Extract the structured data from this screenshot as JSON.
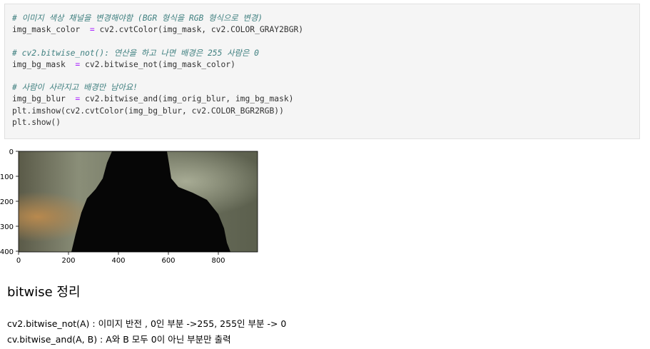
{
  "code": {
    "lines": [
      {
        "kind": "comment",
        "text": "# 이미지 색상 채널을 변경해야함 (BGR 형식을 RGB 형식으로 변경)"
      },
      {
        "kind": "code",
        "parts": [
          "img_mask_color ",
          " = ",
          "cv2.cvtColor(img_mask, cv2.COLOR_GRAY2BGR)"
        ]
      },
      {
        "kind": "blank",
        "text": ""
      },
      {
        "kind": "comment",
        "text": "# cv2.bitwise_not(): 연산을 하고 나면 배경은 255 사람은 0"
      },
      {
        "kind": "code",
        "parts": [
          "img_bg_mask ",
          " = ",
          "cv2.bitwise_not(img_mask_color)"
        ]
      },
      {
        "kind": "blank",
        "text": ""
      },
      {
        "kind": "comment",
        "text": "# 사람이 사라지고 배경만 남아요!"
      },
      {
        "kind": "code",
        "parts": [
          "img_bg_blur ",
          " = ",
          "cv2.bitwise_and(img_orig_blur, img_bg_mask)"
        ]
      },
      {
        "kind": "code",
        "parts": [
          "plt.imshow(cv2.cvtColor(img_bg_blur, cv2.COLOR_BGR2RGB))",
          "",
          ""
        ]
      },
      {
        "kind": "code",
        "parts": [
          "plt.show()",
          "",
          ""
        ]
      }
    ]
  },
  "plot": {
    "y_ticks": [
      "0",
      "100",
      "200",
      "300",
      "400"
    ],
    "x_ticks": [
      "0",
      "200",
      "400",
      "600",
      "800"
    ]
  },
  "markdown": {
    "heading": "bitwise 정리",
    "line1": "cv2.bitwise_not(A) : 이미지 반전 , 0인 부분 ->255, 255인 부분 -> 0",
    "line2": "cv.bitwise_and(A, B) : A와 B 모두 0이 아닌 부분만 출력"
  }
}
